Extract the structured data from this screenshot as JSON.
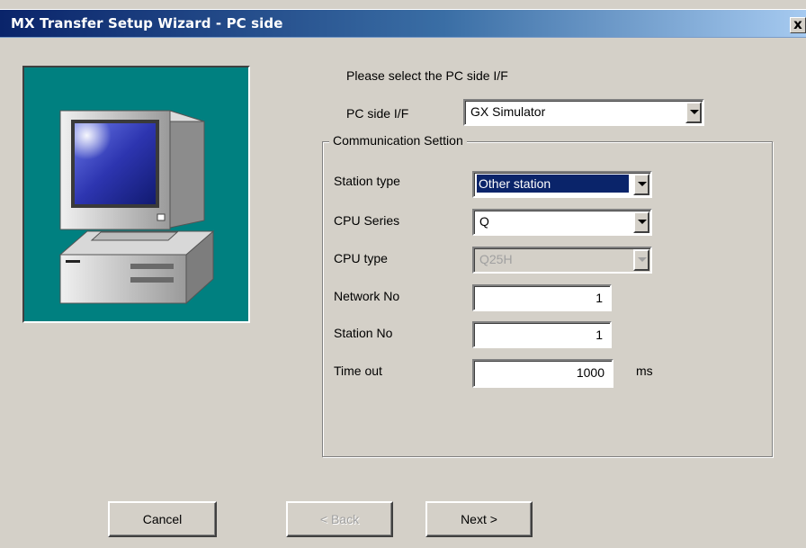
{
  "window": {
    "title": "MX Transfer Setup Wizard - PC side",
    "close_label": "x"
  },
  "intro": {
    "prompt": "Please select the PC side I/F"
  },
  "pc_side": {
    "label": "PC side I/F",
    "value": "GX Simulator"
  },
  "communication": {
    "group_title": "Communication Settion",
    "station_type": {
      "label": "Station type",
      "value": "Other station"
    },
    "cpu_series": {
      "label": "CPU Series",
      "value": "Q"
    },
    "cpu_type": {
      "label": "CPU type",
      "value": "Q25H"
    },
    "network_no": {
      "label": "Network No",
      "value": "1"
    },
    "station_no": {
      "label": "Station No",
      "value": "1"
    },
    "time_out": {
      "label": "Time out",
      "value": "1000",
      "unit": "ms"
    }
  },
  "buttons": {
    "cancel": "Cancel",
    "back": "< Back",
    "next": "Next >"
  },
  "icons": {
    "computer": "computer-illustration-icon",
    "dropdown": "chevron-down-icon"
  }
}
